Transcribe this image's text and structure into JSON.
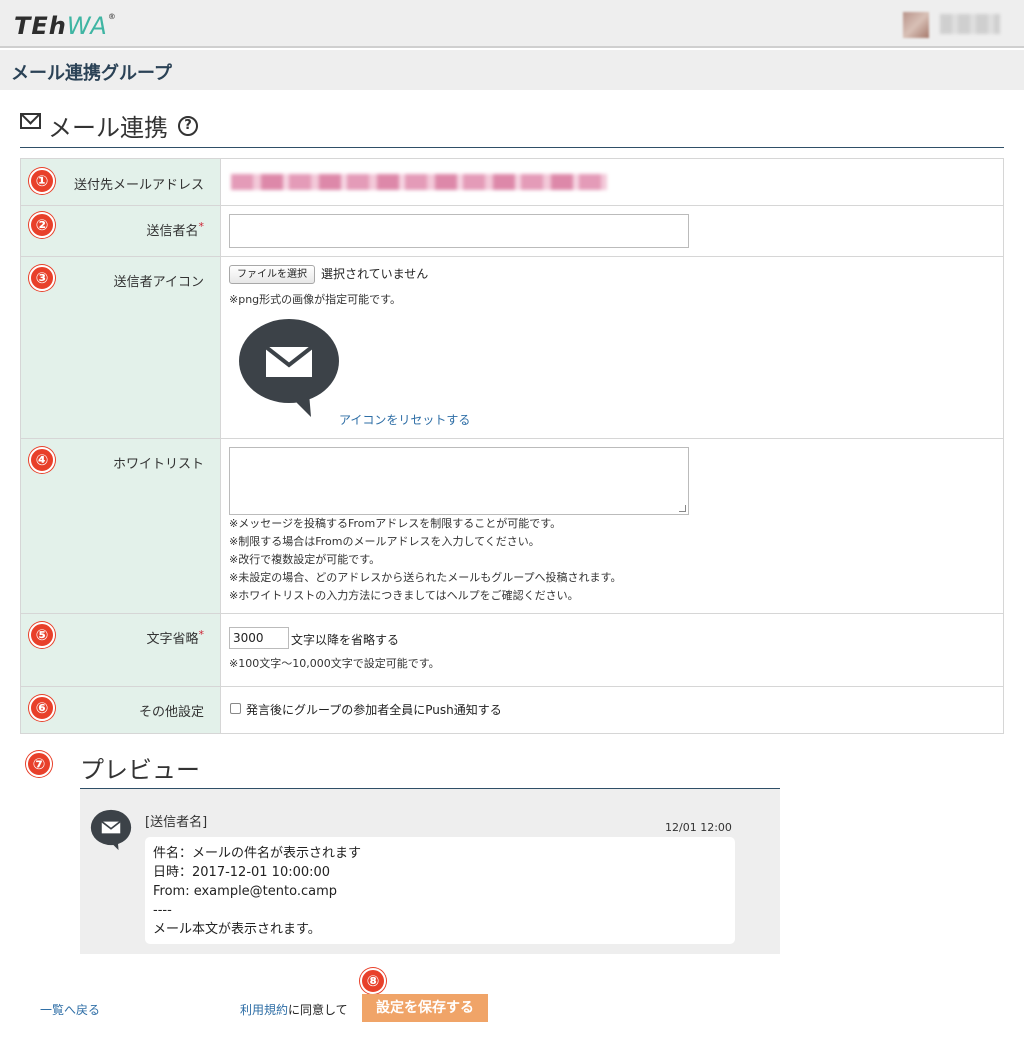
{
  "header": {
    "logo_part1": "TE",
    "logo_part2": "h",
    "logo_part3": "WA",
    "logo_reg": "®"
  },
  "subheader": {
    "title": "メール連携グループ"
  },
  "section": {
    "title": "メール連携",
    "help_glyph": "?"
  },
  "form": {
    "rows": [
      {
        "badge": "①",
        "label": "送付先メールアドレス",
        "required": false
      },
      {
        "badge": "②",
        "label": "送信者名",
        "required": true
      },
      {
        "badge": "③",
        "label": "送信者アイコン",
        "required": false
      },
      {
        "badge": "④",
        "label": "ホワイトリスト",
        "required": false
      },
      {
        "badge": "⑤",
        "label": "文字省略",
        "required": true
      },
      {
        "badge": "⑥",
        "label": "その他設定",
        "required": false
      }
    ],
    "required_mark": "*",
    "sender_name_value": "",
    "file_button_label": "ファイルを選択",
    "file_status": "選択されていません",
    "icon_note": "※png形式の画像が指定可能です。",
    "reset_icon_link": "アイコンをリセットする",
    "whitelist_value": "",
    "whitelist_notes": [
      "※メッセージを投稿するFromアドレスを制限することが可能です。",
      "※制限する場合はFromのメールアドレスを入力してください。",
      "※改行で複数設定が可能です。",
      "※未設定の場合、どのアドレスから送られたメールもグループへ投稿されます。",
      "※ホワイトリストの入力方法につきましてはヘルプをご確認ください。"
    ],
    "truncate_value": "3000",
    "truncate_suffix": "文字以降を省略する",
    "truncate_note": "※100文字〜10,000文字で設定可能です。",
    "push_checkbox_checked": false,
    "push_checkbox_label": "発言後にグループの参加者全員にPush通知する"
  },
  "preview": {
    "badge": "⑦",
    "title": "プレビュー",
    "sender": "[送信者名]",
    "time": "12/01 12:00",
    "message_lines": [
      "件名：メールの件名が表示されます",
      "日時：2017-12-01 10:00:00",
      "From: example@tento.camp",
      "----",
      "メール本文が表示されます。"
    ]
  },
  "footer": {
    "back_link": "一覧へ戻る",
    "terms_link": "利用規約",
    "terms_suffix": "に同意して",
    "save_badge": "⑧",
    "save_button": "設定を保存する"
  },
  "colors": {
    "label_bg": "#e3f1ea",
    "badge_red": "#e8402a",
    "save_orange": "#f0a468",
    "link_blue": "#2e6ea6",
    "logo_teal": "#3fb5a3"
  }
}
